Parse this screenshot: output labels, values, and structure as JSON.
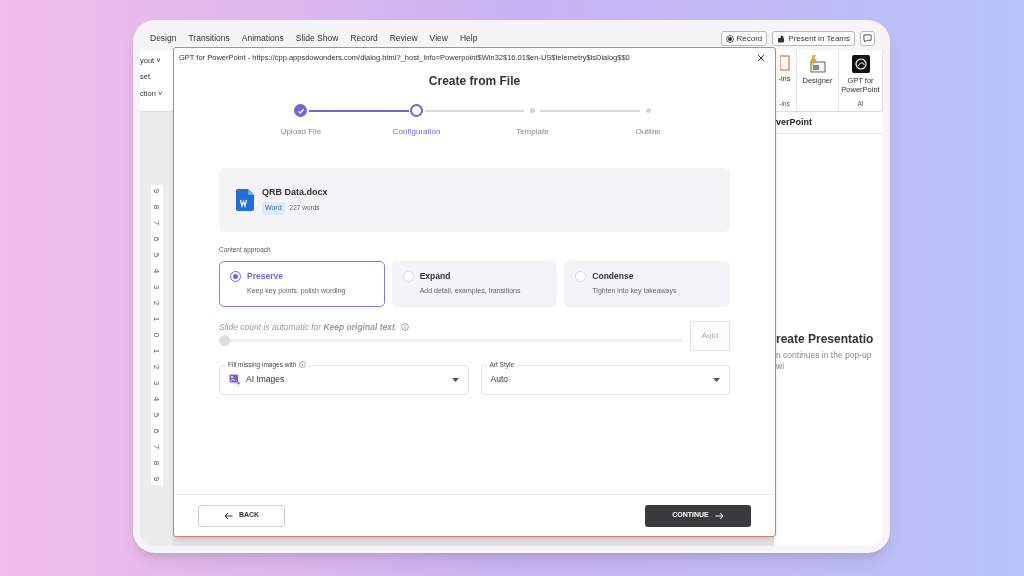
{
  "ppt": {
    "menu": [
      "Design",
      "Transitions",
      "Animations",
      "Slide Show",
      "Record",
      "Review",
      "View",
      "Help"
    ],
    "record_button": "Record",
    "teams_button": "Present in Teams",
    "ribbon_left": [
      "yout ˅",
      "set",
      "ction ˅"
    ],
    "ribbon_right": [
      {
        "label": "-ins",
        "group": "-ins"
      },
      {
        "label": "Designer"
      },
      {
        "label": "GPT for PowerPoint",
        "group": "AI"
      }
    ],
    "ruler": [
      "9",
      "8",
      "7",
      "6",
      "5",
      "4",
      "3",
      "2",
      "1",
      "0",
      "1",
      "2",
      "3",
      "4",
      "5",
      "6",
      "7",
      "8",
      "9"
    ],
    "task_pane": {
      "title": "verPoint",
      "heading": "reate Presentatio",
      "note": "n continues in the pop-up wi"
    }
  },
  "dialog": {
    "title": "GPT for PowerPoint - https://cpp.appsdowonders.com/dialog.html?_host_Info=Powerpoint$Win32$16.01$en-US$telemetry$isDialog$$0",
    "heading": "Create from File",
    "steps": [
      {
        "label": "Upload File",
        "done": true,
        "selected": false
      },
      {
        "label": "Configuration",
        "done": false,
        "selected": true
      },
      {
        "label": "Template",
        "done": false,
        "selected": false
      },
      {
        "label": "Outline",
        "done": false,
        "selected": false
      }
    ],
    "file": {
      "name": "QRB Data.docx",
      "type": "Word",
      "words": "227 words"
    },
    "approach_label": "Content approach",
    "options": [
      {
        "title": "Preserve",
        "description": "Keep key points, polish wording",
        "selected": true
      },
      {
        "title": "Expand",
        "description": "Add detail, examples, transitions",
        "selected": false
      },
      {
        "title": "Condense",
        "description": "Tighten into key takeaways",
        "selected": false
      }
    ],
    "slide_count": {
      "text": "Slide count is automatic for **Keep original text**.",
      "level": 0,
      "disabled": true,
      "placeholder": "Auto"
    },
    "dropdowns": [
      {
        "label": "Fill missing images with",
        "value": "AI Images",
        "info": true,
        "icon": true
      },
      {
        "label": "Art Style",
        "value": "Auto",
        "info": false,
        "icon": false
      }
    ],
    "back": "BACK",
    "continue": "CONTINUE"
  }
}
